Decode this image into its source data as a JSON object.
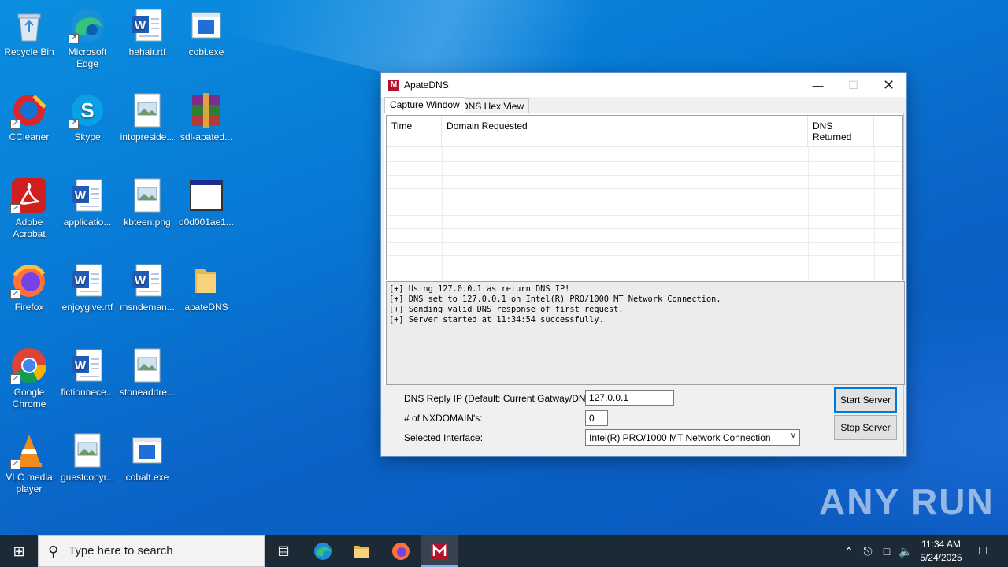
{
  "desktop": {
    "icons": [
      {
        "label": "Recycle Bin"
      },
      {
        "label": "Microsoft Edge"
      },
      {
        "label": "hehair.rtf"
      },
      {
        "label": "cobi.exe"
      },
      {
        "label": "CCleaner"
      },
      {
        "label": "Skype"
      },
      {
        "label": "intopreside..."
      },
      {
        "label": "sdl-apated..."
      },
      {
        "label": "Adobe Acrobat"
      },
      {
        "label": "applicatio..."
      },
      {
        "label": "kbteen.png"
      },
      {
        "label": "d0d001ae1..."
      },
      {
        "label": "Firefox"
      },
      {
        "label": "enjoygive.rtf"
      },
      {
        "label": "msndeman..."
      },
      {
        "label": "apateDNS"
      },
      {
        "label": "Google Chrome"
      },
      {
        "label": "fictionnece..."
      },
      {
        "label": "stoneaddre..."
      },
      {
        "label": "VLC media player"
      },
      {
        "label": "guestcopyr..."
      },
      {
        "label": "cobalt.exe"
      }
    ]
  },
  "window": {
    "title": "ApateDNS",
    "app_icon_letter": "M",
    "tabs": [
      {
        "label": "Capture Window",
        "active": true
      },
      {
        "label": "DNS Hex View",
        "active": false
      }
    ],
    "grid": {
      "columns": [
        "Time",
        "Domain Requested",
        "DNS Returned"
      ]
    },
    "log": [
      "[+] Using 127.0.0.1 as return DNS IP!",
      "[+] DNS set to 127.0.0.1 on Intel(R) PRO/1000 MT Network Connection.",
      "[+] Sending valid DNS response of first request.",
      "[+] Server started at 11:34:54 successfully."
    ],
    "form": {
      "dns_reply_label": "DNS Reply IP (Default: Current Gatway/DNS):",
      "dns_reply_value": "127.0.0.1",
      "nxdomain_label": "# of NXDOMAIN's:",
      "nxdomain_value": "0",
      "interface_label": "Selected Interface:",
      "interface_value": "Intel(R) PRO/1000 MT Network Connection",
      "start_button": "Start Server",
      "stop_button": "Stop Server"
    }
  },
  "watermark": "ANY RUN",
  "taskbar": {
    "search_placeholder": "Type here to search",
    "time": "11:34 AM",
    "date": "5/24/2025"
  }
}
